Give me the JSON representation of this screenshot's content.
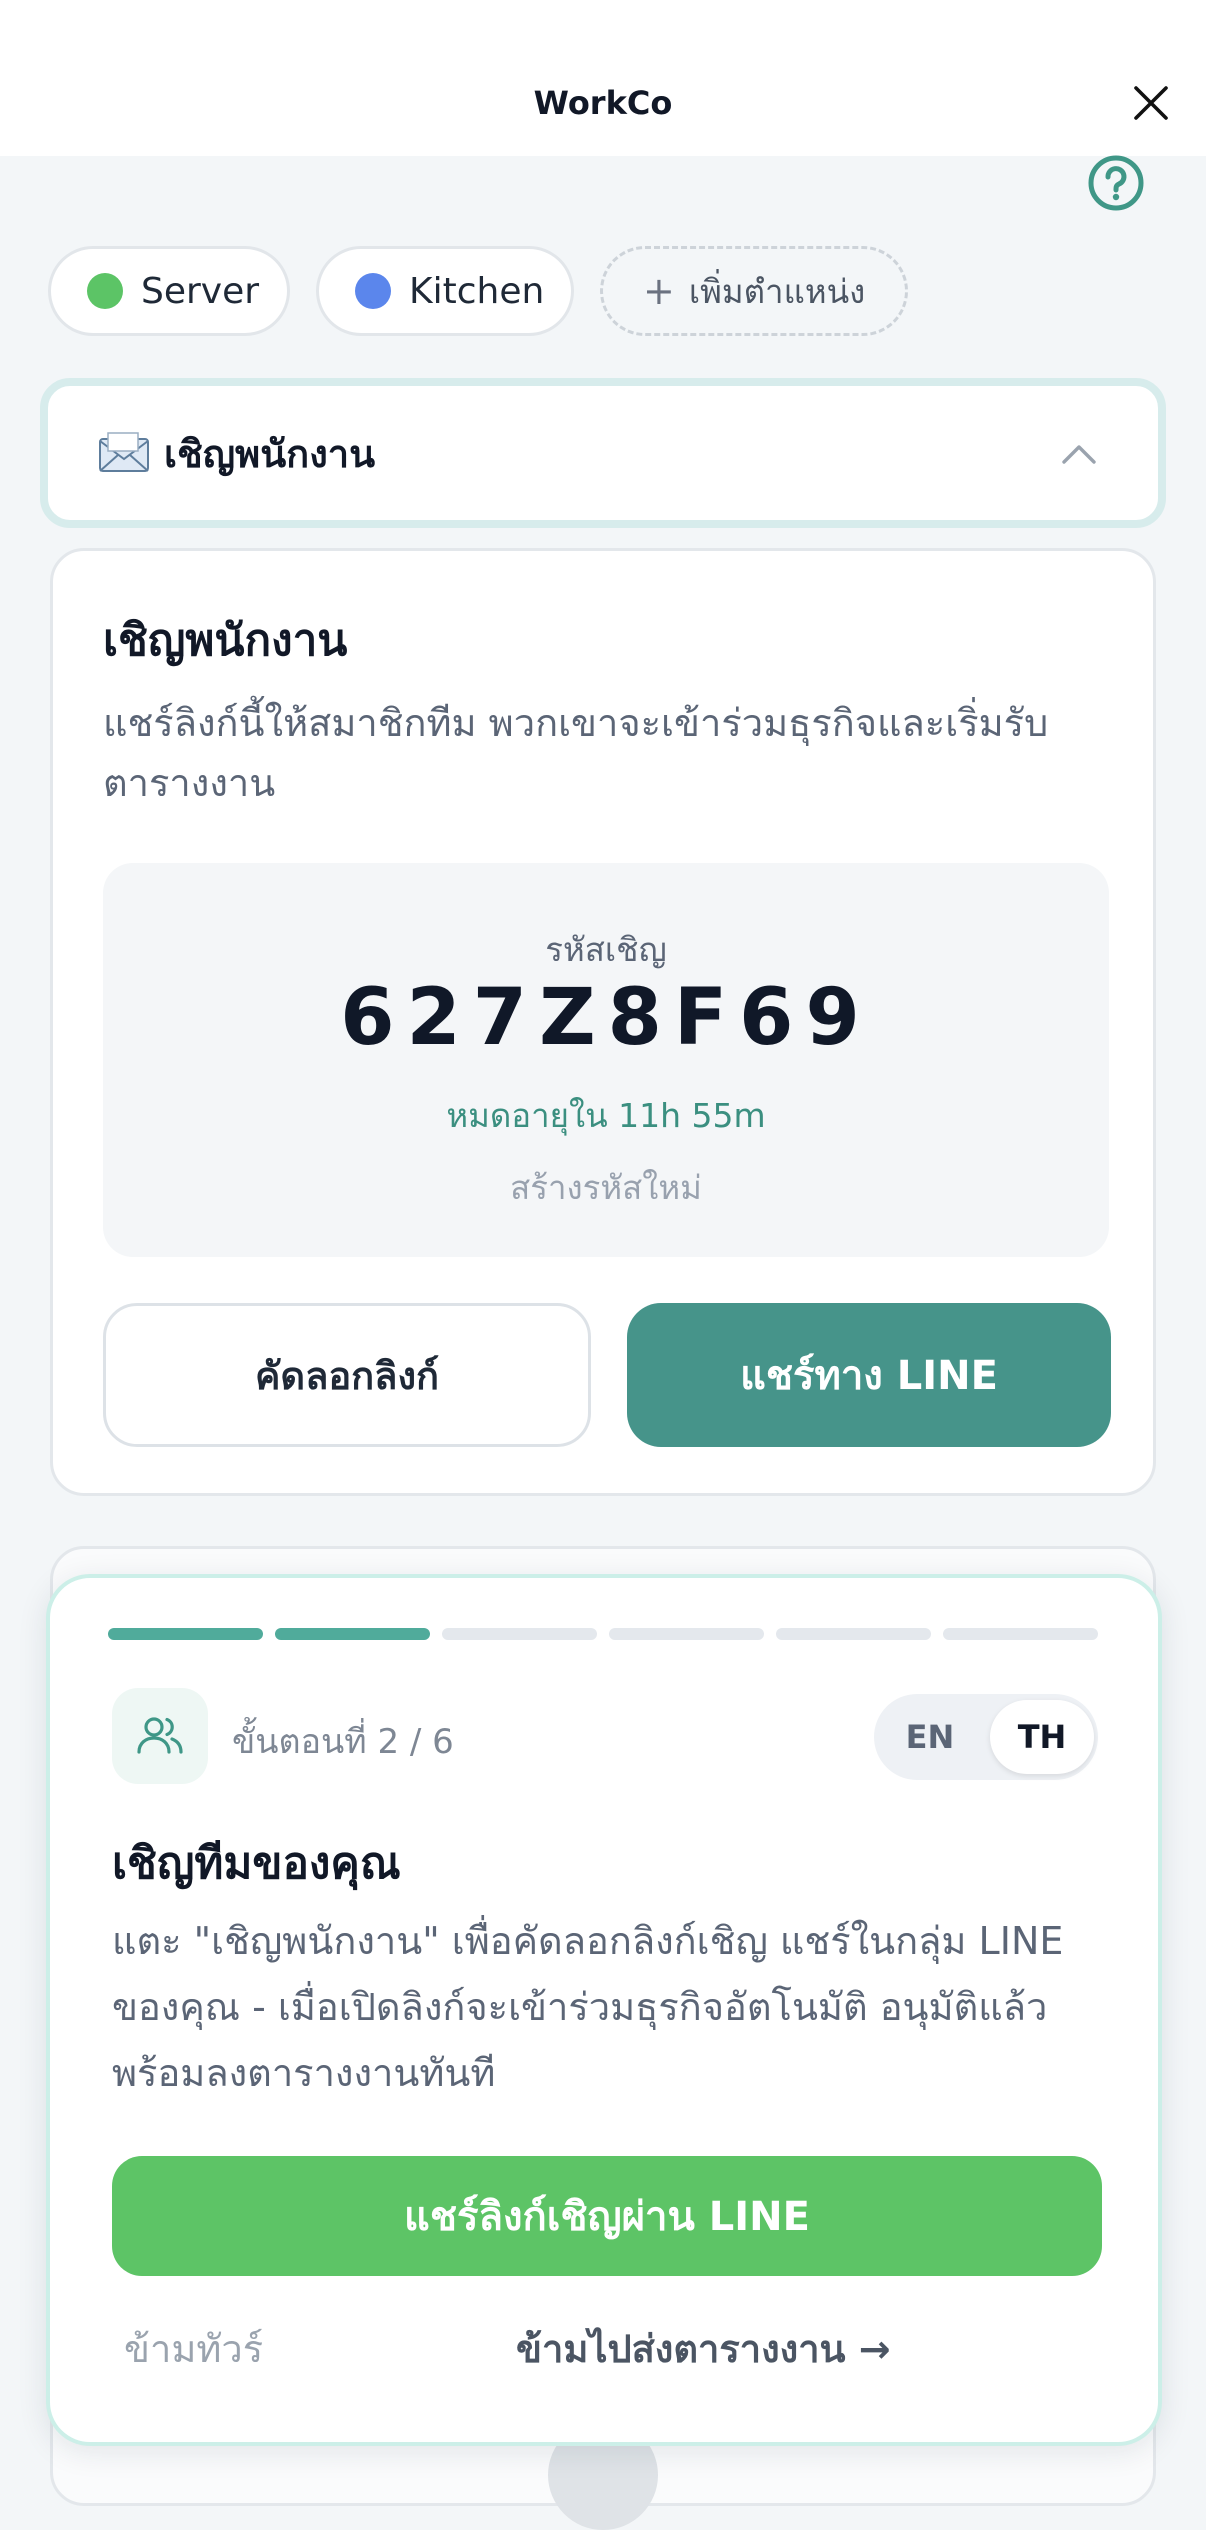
{
  "header": {
    "title": "WorkCo",
    "close_icon": "close-icon"
  },
  "help_icon": "help-circle-icon",
  "positions": [
    {
      "label": "Server",
      "color": "#5cc466"
    },
    {
      "label": "Kitchen",
      "color": "#5b86ec"
    }
  ],
  "add_position_label": "เพิ่มตำแหน่ง",
  "invite_section": {
    "emoji": "envelope-icon",
    "label": "เชิญพนักงาน"
  },
  "invite_card": {
    "title": "เชิญพนักงาน",
    "description": "แชร์ลิงก์นี้ให้สมาชิกทีม พวกเขาจะเข้าร่วมธุรกิจและเริ่มรับตารางงาน",
    "code_label": "รหัสเชิญ",
    "code": "627Z8F69",
    "expires": "หมดอายุใน 11h 55m",
    "regenerate": "สร้างรหัสใหม่",
    "copy_button": "คัดลอกลิงก์",
    "line_button": "แชร์ทาง LINE"
  },
  "tour": {
    "total_steps": 6,
    "current_step": 2,
    "step_text": "ขั้นตอนที่ 2 / 6",
    "lang_en": "EN",
    "lang_th": "TH",
    "title": "เชิญทีมของคุณ",
    "description": "แตะ \"เชิญพนักงาน\" เพื่อคัดลอกลิงก์เชิญ แชร์ในกลุ่ม LINE ของคุณ - เมื่อเปิดลิงก์จะเข้าร่วมธุรกิจอัตโนมัติ อนุมัติแล้วพร้อมลงตารางงานทันที",
    "share_button": "แชร์ลิงก์เชิญผ่าน LINE",
    "skip_tour": "ข้ามทัวร์",
    "skip_to_schedule": "ข้ามไปส่งตารางงาน →"
  },
  "colors": {
    "accent": "#46948a",
    "line_green": "#5dc466",
    "progress_on": "#50ab9b"
  }
}
